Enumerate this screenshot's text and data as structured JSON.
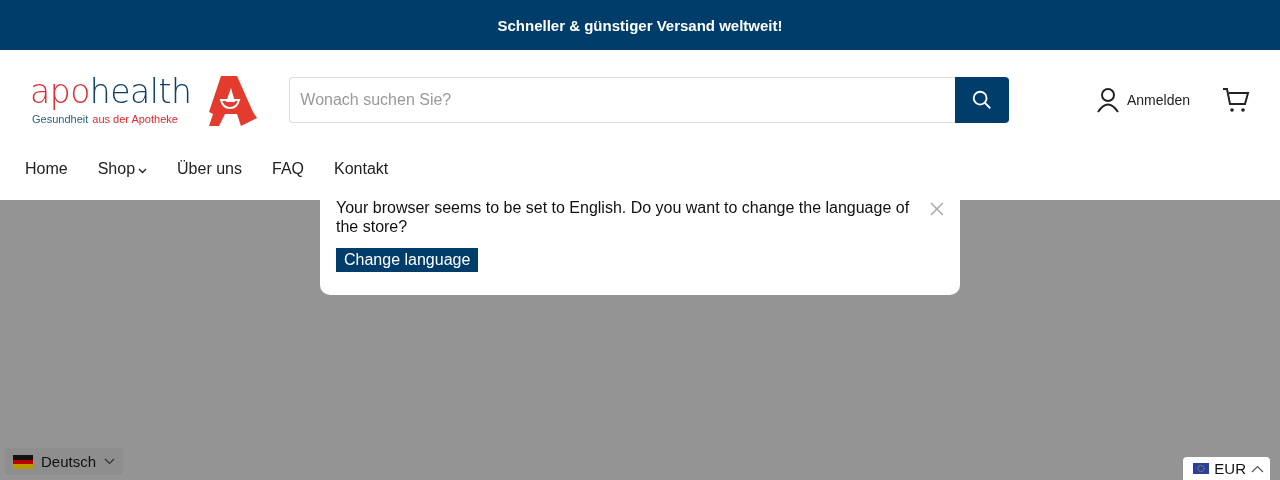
{
  "announcement": "Schneller & günstiger Versand weltweit!",
  "logo": {
    "wordmark": [
      {
        "text": "apo",
        "color": "#e0282e"
      },
      {
        "text": "health",
        "color": "#0b3d66"
      }
    ],
    "tagline": [
      {
        "text": "Gesundheit",
        "color": "#2a5f86"
      },
      {
        "text": "aus der Apotheke",
        "color": "#e0282e"
      }
    ]
  },
  "search": {
    "placeholder": "Wonach suchen Sie?"
  },
  "account": {
    "label": "Anmelden"
  },
  "nav": [
    {
      "label": "Home",
      "has_menu": false
    },
    {
      "label": "Shop",
      "has_menu": true
    },
    {
      "label": "Über uns",
      "has_menu": false
    },
    {
      "label": "FAQ",
      "has_menu": false
    },
    {
      "label": "Kontakt",
      "has_menu": false
    }
  ],
  "language_popup": {
    "message": "Your browser seems to be set to English. Do you want to change the language of the store?",
    "button": "Change language"
  },
  "language_selector": {
    "label": "Deutsch"
  },
  "currency_selector": {
    "label": "EUR"
  }
}
